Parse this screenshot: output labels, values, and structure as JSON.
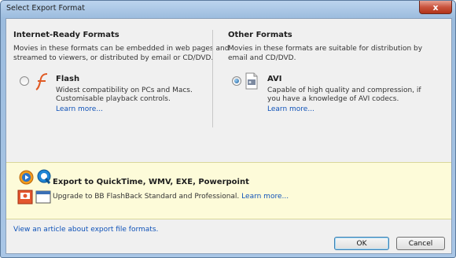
{
  "window": {
    "title": "Select Export Format",
    "close_glyph": "x"
  },
  "internet": {
    "heading": "Internet-Ready Formats",
    "description_line1": "Movies in these formats can be embedded in web pages and",
    "description_line2": "streamed to viewers, or distributed by email or CD/DVD.",
    "format": {
      "name": "Flash",
      "desc_line1": "Widest compatibility on PCs and Macs.",
      "desc_line2": "Customisable playback controls.",
      "learn_more": "Learn more...",
      "selected": false,
      "icon": "flash-icon"
    }
  },
  "other": {
    "heading": "Other Formats",
    "description_line1": "Movies in these formats are suitable for distribution by",
    "description_line2": "email and CD/DVD.",
    "format": {
      "name": "AVI",
      "desc_line1": "Capable of high quality and compression, if",
      "desc_line2": "you have a knowledge of AVI codecs.",
      "learn_more": "Learn more...",
      "selected": true,
      "icon": "avi-file-icon"
    }
  },
  "upgrade": {
    "title": "Export to QuickTime, WMV, EXE, Powerpoint",
    "text": "Upgrade to BB FlashBack Standard and Professional.",
    "link": "Learn more...",
    "icons": [
      "windows-media-icon",
      "quicktime-icon",
      "powerpoint-icon",
      "exe-window-icon"
    ]
  },
  "article_link": "View an article about export file formats.",
  "buttons": {
    "ok": "OK",
    "cancel": "Cancel"
  },
  "colors": {
    "accent_link": "#0f52b8",
    "upgrade_bg": "#fdfbd9",
    "title_bar": "#a9c6e6"
  }
}
